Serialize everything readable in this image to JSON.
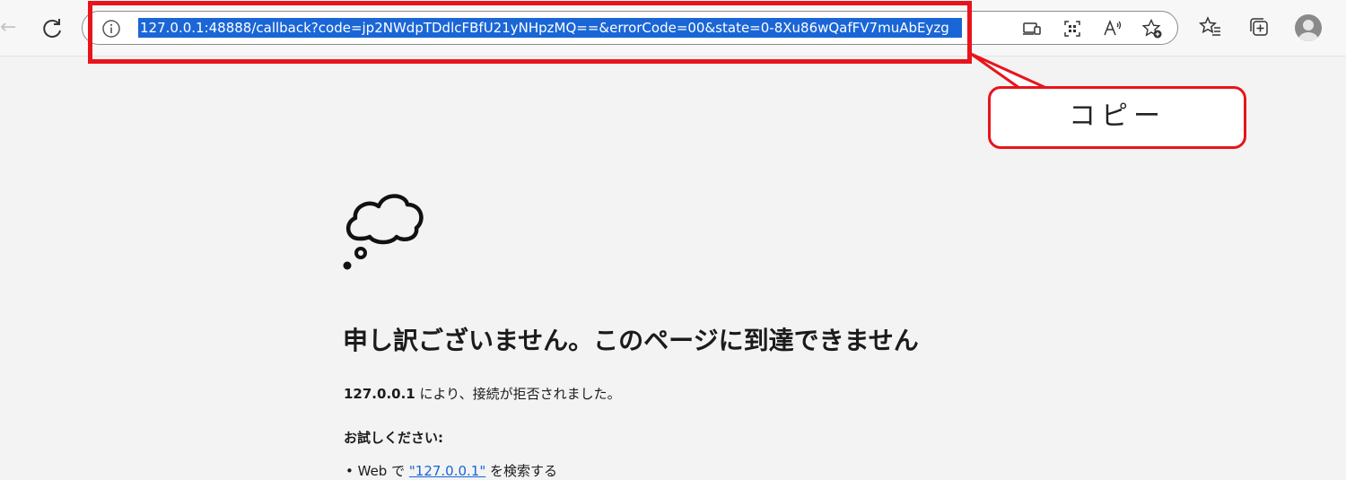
{
  "browser": {
    "address_bar": {
      "url": "127.0.0.1:48888/callback?code=jp2NWdpTDdlcFBfU21yNHpzMQ==&errorCode=00&state=0-8Xu86wQafFV7muAbEyzg",
      "selected": true
    },
    "icons": {
      "back": "back-arrow-icon",
      "refresh": "refresh-icon",
      "info": "info-icon",
      "app": "app-available-icon",
      "qr": "qr-code-icon",
      "read_aloud": "read-aloud-icon",
      "favorite_add": "add-favorite-icon",
      "favorites": "favorites-icon",
      "collections": "collections-icon",
      "profile": "profile-avatar-icon"
    }
  },
  "annotation": {
    "callout_label": "コピー",
    "color": "#e8141b"
  },
  "error_page": {
    "heading": "申し訳ございません。このページに到達できません",
    "host": "127.0.0.1",
    "detail_suffix": " により、接続が拒否されました。",
    "try_heading": "お試しください:",
    "suggestion_prefix": "Web で ",
    "suggestion_link": "\"127.0.0.1\"",
    "suggestion_suffix": " を検索する"
  },
  "colors": {
    "selection": "#1a66d6",
    "background": "#f3f3f3",
    "annotation_red": "#e8141b"
  }
}
